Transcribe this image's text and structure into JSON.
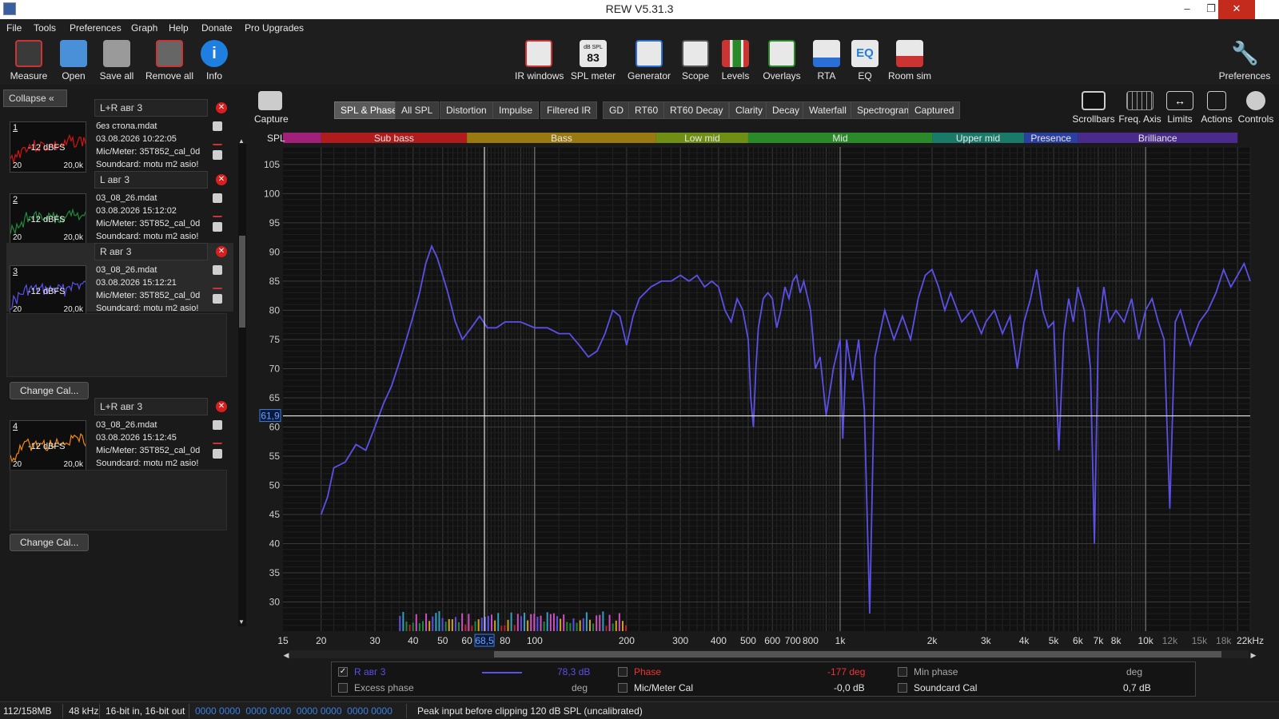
{
  "window": {
    "title": "REW V5.31.3",
    "minimize": "–",
    "restore": "❐",
    "close": "✕"
  },
  "menu": [
    "File",
    "Tools",
    "Preferences",
    "Graph",
    "Help",
    "Donate",
    "Pro Upgrades"
  ],
  "toolbar_left": [
    {
      "label": "Measure",
      "icon": "measure-icon",
      "color": "#c33"
    },
    {
      "label": "Open",
      "icon": "folder-icon",
      "color": "#4a90d9"
    },
    {
      "label": "Save all",
      "icon": "save-icon",
      "color": "#aaa"
    },
    {
      "label": "Remove all",
      "icon": "remove-all-icon",
      "color": "#c33"
    },
    {
      "label": "Info",
      "icon": "info-icon",
      "color": "#1f7fe0"
    }
  ],
  "toolbar_center": [
    {
      "label": "IR windows",
      "icon": "ir-windows-icon",
      "color": "#c33"
    },
    {
      "label": "SPL meter",
      "icon": "spl-meter-icon",
      "badge": "83",
      "badge_top": "dB SPL",
      "color": "#ddd"
    },
    {
      "label": "Generator",
      "icon": "generator-icon",
      "color": "#2a6fd6"
    },
    {
      "label": "Scope",
      "icon": "scope-icon",
      "color": "#666"
    },
    {
      "label": "Levels",
      "icon": "levels-icon",
      "color": "#c33"
    },
    {
      "label": "Overlays",
      "icon": "overlays-icon",
      "color": "#c8c8c8"
    },
    {
      "label": "RTA",
      "icon": "rta-icon",
      "color": "#2a6fd6"
    },
    {
      "label": "EQ",
      "icon": "eq-icon",
      "badge": "EQ",
      "color": "#1f7fe0"
    },
    {
      "label": "Room sim",
      "icon": "room-sim-icon",
      "color": "#c33"
    }
  ],
  "toolbar_right": {
    "label": "Preferences",
    "icon": "wrench-icon"
  },
  "graph_tools": [
    {
      "label": "Scrollbars",
      "icon": "scrollbars-icon"
    },
    {
      "label": "Freq. Axis",
      "icon": "freq-axis-icon"
    },
    {
      "label": "Limits",
      "icon": "limits-icon"
    },
    {
      "label": "Actions",
      "icon": "actions-icon"
    },
    {
      "label": "Controls",
      "icon": "controls-icon"
    }
  ],
  "capture": {
    "label": "Capture",
    "icon": "camera-icon"
  },
  "collapse": {
    "label": "Collapse",
    "icon": "double-chevron-left-icon"
  },
  "measurements": [
    {
      "num": "1",
      "title": "L+R авг 3",
      "lines": [
        "без стола.mdat",
        "03.08.2026 10:22:05",
        "Mic/Meter: 35T852_cal_0d",
        "Soundcard: motu m2 asio!"
      ],
      "color": "#d01515",
      "db": "-12 dBFS",
      "lo": "20",
      "hi": "20,0k",
      "selected": false
    },
    {
      "num": "2",
      "title": "L авг 3",
      "lines": [
        "03_08_26.mdat",
        "03.08.2026 15:12:02",
        "Mic/Meter: 35T852_cal_0d",
        "Soundcard: motu m2 asio!"
      ],
      "color": "#1f8a3c",
      "db": "-12 dBFS",
      "lo": "20",
      "hi": "20,0k",
      "selected": false
    },
    {
      "num": "3",
      "title": "R авг 3",
      "lines": [
        "03_08_26.mdat",
        "03.08.2026 15:12:21",
        "Mic/Meter: 35T852_cal_0d",
        "Soundcard: motu m2 asio!"
      ],
      "color": "#5b50e8",
      "db": "-12 dBFS",
      "lo": "20",
      "hi": "20,0k",
      "selected": true
    },
    {
      "num": "4",
      "title": "L+R авг 3",
      "lines": [
        "03_08_26.mdat",
        "03.08.2026 15:12:45",
        "Mic/Meter: 35T852_cal_0d",
        "Soundcard: motu m2 asio!"
      ],
      "color": "#f08a10",
      "db": "-12 dBFS",
      "lo": "20",
      "hi": "20,0k",
      "selected": false
    }
  ],
  "change_cal_label": "Change Cal...",
  "tabs": [
    "SPL & Phase",
    "All SPL",
    "Distortion",
    "Impulse",
    "Filtered IR",
    "GD",
    "RT60",
    "RT60 Decay",
    "Clarity",
    "Decay",
    "Waterfall",
    "Spectrogram",
    "Captured"
  ],
  "active_tab": "SPL & Phase",
  "bands": [
    {
      "label": "",
      "from": 15,
      "to": 20,
      "color": "#a0207a"
    },
    {
      "label": "Sub bass",
      "from": 20,
      "to": 60,
      "color": "#b01c1c"
    },
    {
      "label": "Bass",
      "from": 60,
      "to": 250,
      "color": "#9a7a10"
    },
    {
      "label": "Low mid",
      "from": 250,
      "to": 500,
      "color": "#6f8f14"
    },
    {
      "label": "Mid",
      "from": 500,
      "to": 2000,
      "color": "#2a8a2a"
    },
    {
      "label": "Upper mid",
      "from": 2000,
      "to": 4000,
      "color": "#1a7a6a"
    },
    {
      "label": "Presence",
      "from": 4000,
      "to": 6000,
      "color": "#2a3fa0"
    },
    {
      "label": "Brilliance",
      "from": 6000,
      "to": 20000,
      "color": "#4a2a8a"
    }
  ],
  "chart_data": {
    "type": "line",
    "ylabel": "SPL",
    "xscale": "log",
    "xlim": [
      15,
      22000
    ],
    "ylim": [
      25,
      108
    ],
    "yticks": [
      30,
      35,
      40,
      45,
      50,
      55,
      60,
      65,
      70,
      75,
      80,
      85,
      90,
      95,
      100,
      105
    ],
    "xticks": [
      {
        "v": 15,
        "t": "15"
      },
      {
        "v": 20,
        "t": "20"
      },
      {
        "v": 30,
        "t": "30"
      },
      {
        "v": 40,
        "t": "40"
      },
      {
        "v": 50,
        "t": "50"
      },
      {
        "v": 60,
        "t": "60"
      },
      {
        "v": 80,
        "t": "80"
      },
      {
        "v": 100,
        "t": "100"
      },
      {
        "v": 200,
        "t": "200"
      },
      {
        "v": 300,
        "t": "300"
      },
      {
        "v": 400,
        "t": "400"
      },
      {
        "v": 500,
        "t": "500"
      },
      {
        "v": 600,
        "t": "600"
      },
      {
        "v": 700,
        "t": "700"
      },
      {
        "v": 800,
        "t": "800"
      },
      {
        "v": 1000,
        "t": "1k"
      },
      {
        "v": 2000,
        "t": "2k"
      },
      {
        "v": 3000,
        "t": "3k"
      },
      {
        "v": 4000,
        "t": "4k"
      },
      {
        "v": 5000,
        "t": "5k"
      },
      {
        "v": 6000,
        "t": "6k"
      },
      {
        "v": 7000,
        "t": "7k"
      },
      {
        "v": 8000,
        "t": "8k"
      },
      {
        "v": 10000,
        "t": "10k"
      },
      {
        "v": 12000,
        "t": "12k"
      },
      {
        "v": 15000,
        "t": "15k"
      },
      {
        "v": 18000,
        "t": "18k"
      },
      {
        "v": 22000,
        "t": "22kHz"
      }
    ],
    "cursor": {
      "x": 68.5,
      "y": 61.9,
      "xlabel": "68,5",
      "ylabel": "61,9"
    },
    "series": [
      {
        "name": "R авг 3",
        "color": "#5b50e8",
        "points": [
          [
            20,
            45
          ],
          [
            21,
            48
          ],
          [
            22,
            53
          ],
          [
            24,
            54
          ],
          [
            26,
            57
          ],
          [
            28,
            56
          ],
          [
            30,
            60
          ],
          [
            32,
            64
          ],
          [
            34,
            67
          ],
          [
            36,
            71
          ],
          [
            38,
            75
          ],
          [
            40,
            79
          ],
          [
            42,
            83
          ],
          [
            44,
            88
          ],
          [
            46,
            91
          ],
          [
            48,
            89
          ],
          [
            50,
            86
          ],
          [
            52,
            83
          ],
          [
            55,
            78
          ],
          [
            58,
            75
          ],
          [
            62,
            77
          ],
          [
            66,
            79
          ],
          [
            70,
            77
          ],
          [
            75,
            77
          ],
          [
            80,
            78
          ],
          [
            90,
            78
          ],
          [
            100,
            77
          ],
          [
            110,
            77
          ],
          [
            120,
            76
          ],
          [
            130,
            76
          ],
          [
            140,
            74
          ],
          [
            150,
            72
          ],
          [
            160,
            73
          ],
          [
            170,
            76
          ],
          [
            180,
            80
          ],
          [
            190,
            79
          ],
          [
            200,
            74
          ],
          [
            210,
            79
          ],
          [
            220,
            82
          ],
          [
            240,
            84
          ],
          [
            260,
            85
          ],
          [
            280,
            85
          ],
          [
            300,
            86
          ],
          [
            320,
            85
          ],
          [
            340,
            86
          ],
          [
            360,
            84
          ],
          [
            380,
            85
          ],
          [
            400,
            84
          ],
          [
            420,
            80
          ],
          [
            440,
            78
          ],
          [
            460,
            82
          ],
          [
            480,
            80
          ],
          [
            500,
            75
          ],
          [
            510,
            65
          ],
          [
            520,
            60
          ],
          [
            530,
            70
          ],
          [
            540,
            77
          ],
          [
            560,
            82
          ],
          [
            580,
            83
          ],
          [
            600,
            82
          ],
          [
            620,
            77
          ],
          [
            640,
            80
          ],
          [
            660,
            84
          ],
          [
            680,
            82
          ],
          [
            700,
            85
          ],
          [
            720,
            86
          ],
          [
            740,
            83
          ],
          [
            760,
            85
          ],
          [
            800,
            80
          ],
          [
            830,
            70
          ],
          [
            860,
            72
          ],
          [
            900,
            62
          ],
          [
            950,
            70
          ],
          [
            1000,
            75
          ],
          [
            1020,
            58
          ],
          [
            1050,
            75
          ],
          [
            1100,
            68
          ],
          [
            1150,
            75
          ],
          [
            1200,
            63
          ],
          [
            1250,
            28
          ],
          [
            1300,
            72
          ],
          [
            1400,
            80
          ],
          [
            1500,
            75
          ],
          [
            1600,
            79
          ],
          [
            1700,
            75
          ],
          [
            1800,
            82
          ],
          [
            1900,
            86
          ],
          [
            2000,
            87
          ],
          [
            2100,
            84
          ],
          [
            2200,
            80
          ],
          [
            2300,
            83
          ],
          [
            2500,
            78
          ],
          [
            2700,
            80
          ],
          [
            2900,
            76
          ],
          [
            3000,
            78
          ],
          [
            3200,
            80
          ],
          [
            3400,
            76
          ],
          [
            3600,
            79
          ],
          [
            3800,
            70
          ],
          [
            4000,
            78
          ],
          [
            4200,
            82
          ],
          [
            4400,
            87
          ],
          [
            4600,
            80
          ],
          [
            4800,
            77
          ],
          [
            5000,
            78
          ],
          [
            5200,
            56
          ],
          [
            5400,
            76
          ],
          [
            5600,
            82
          ],
          [
            5800,
            78
          ],
          [
            6000,
            84
          ],
          [
            6300,
            80
          ],
          [
            6600,
            70
          ],
          [
            6800,
            40
          ],
          [
            7000,
            76
          ],
          [
            7300,
            84
          ],
          [
            7600,
            78
          ],
          [
            8000,
            80
          ],
          [
            8500,
            78
          ],
          [
            9000,
            82
          ],
          [
            9500,
            75
          ],
          [
            10000,
            80
          ],
          [
            10500,
            82
          ],
          [
            11000,
            78
          ],
          [
            11500,
            75
          ],
          [
            12000,
            46
          ],
          [
            12500,
            78
          ],
          [
            13000,
            80
          ],
          [
            14000,
            74
          ],
          [
            15000,
            78
          ],
          [
            16000,
            80
          ],
          [
            17000,
            83
          ],
          [
            18000,
            87
          ],
          [
            19000,
            84
          ],
          [
            20000,
            86
          ],
          [
            21000,
            88
          ],
          [
            22000,
            85
          ]
        ]
      }
    ]
  },
  "legend": {
    "row1": {
      "name": "R авг 3",
      "value": "78,3 dB",
      "phase_label": "Phase",
      "phase_value": "-177 deg",
      "minphase_label": "Min phase",
      "minphase_unit": "deg"
    },
    "row2": {
      "excess_label": "Excess phase",
      "excess_unit": "deg",
      "miccal_label": "Mic/Meter Cal",
      "miccal_value": "-0,0 dB",
      "sccal_label": "Soundcard Cal",
      "sccal_value": "0,7 dB"
    }
  },
  "status": [
    "112/158MB",
    "48 kHz",
    "16-bit in, 16-bit out",
    "0000 0000  0000 0000  0000 0000  0000 0000",
    "Peak input before clipping 120 dB SPL (uncalibrated)"
  ]
}
